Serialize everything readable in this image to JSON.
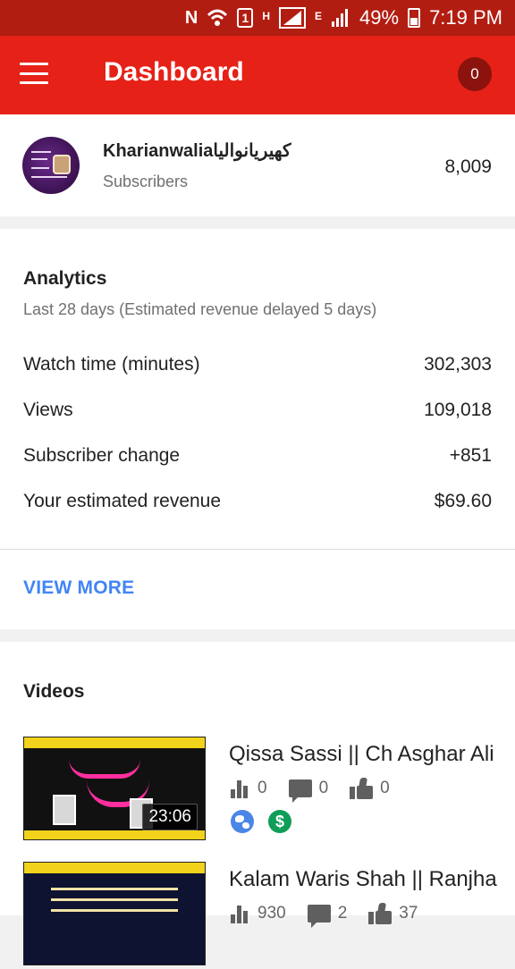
{
  "status_bar": {
    "time": "7:19 PM",
    "battery": "49%",
    "network_h": "H",
    "network_e": "E",
    "sim_slot": "1",
    "notification_letter": "N"
  },
  "app_bar": {
    "title": "Dashboard",
    "notification_count": "0"
  },
  "channel": {
    "name": "Kharianwaliaکھیریانوالیا",
    "subscribers_label": "Subscribers",
    "subscribers_count": "8,009"
  },
  "analytics": {
    "title": "Analytics",
    "subtitle": "Last 28 days (Estimated revenue delayed 5 days)",
    "metrics": [
      {
        "label": "Watch time (minutes)",
        "value": "302,303"
      },
      {
        "label": "Views",
        "value": "109,018"
      },
      {
        "label": "Subscriber change",
        "value": "+851"
      },
      {
        "label": "Your estimated revenue",
        "value": "$69.60"
      }
    ],
    "view_more": "VIEW MORE"
  },
  "videos": {
    "title": "Videos",
    "items": [
      {
        "title": "Qissa Sassi || Ch Asghar Ali",
        "duration": "23:06",
        "views": "0",
        "comments": "0",
        "likes": "0"
      },
      {
        "title": "Kalam Waris Shah || Ranjha",
        "views": "930",
        "comments": "2",
        "likes": "37"
      }
    ]
  },
  "icons": {
    "menu": "menu-icon",
    "views": "bar-chart-icon",
    "comments": "comment-icon",
    "likes": "thumbs-up-icon",
    "public": "globe-icon",
    "monetized": "dollar-icon"
  },
  "colors": {
    "app_bar": "#e62117",
    "status_bar": "#b21d12",
    "badge": "#8b120d",
    "link": "#4285f4",
    "monetized": "#0f9d58",
    "public": "#4a86e8"
  }
}
